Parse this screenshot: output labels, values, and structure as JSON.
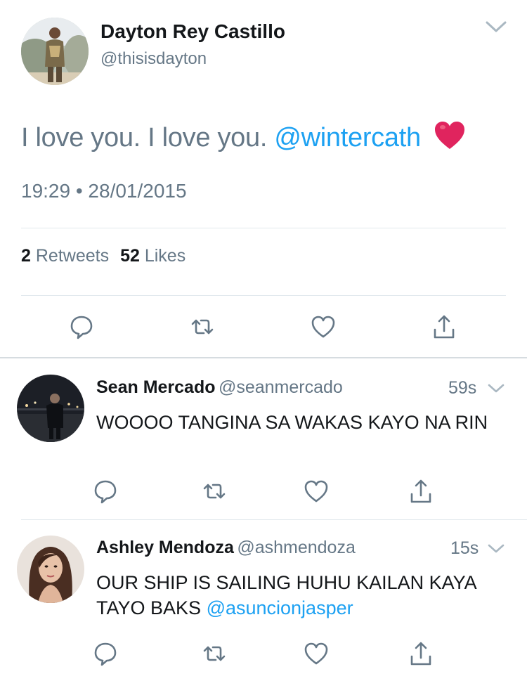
{
  "main_tweet": {
    "author_name": "Dayton Rey Castillo",
    "author_handle": "@thisisdayton",
    "text": "I love you. I love you.",
    "mention": "@wintercath",
    "emoji": "red-heart-emoji",
    "timestamp": "19:29 • 28/01/2015",
    "retweets_count": "2",
    "retweets_label": "Retweets",
    "likes_count": "52",
    "likes_label": "Likes"
  },
  "replies": [
    {
      "author_name": "Sean Mercado",
      "author_handle": "@seanmercado",
      "time": "59s",
      "text": "WOOOO TANGINA SA WAKAS KAYO NA RIN",
      "mention": ""
    },
    {
      "author_name": "Ashley Mendoza",
      "author_handle": "@ashmendoza",
      "time": "15s",
      "text": "OUR SHIP IS SAILING HUHU KAILAN KAYA TAYO BAKS",
      "mention": "@asuncionjasper"
    }
  ],
  "icons": {
    "reply": "reply-icon",
    "retweet": "retweet-icon",
    "like": "heart-icon",
    "share": "share-icon",
    "more": "chevron-down-icon"
  },
  "colors": {
    "link": "#1da1f2",
    "secondary_text": "#657786",
    "primary_text": "#14171a",
    "divider": "#e1e8ed",
    "emoji_heart": "#e0245e"
  }
}
